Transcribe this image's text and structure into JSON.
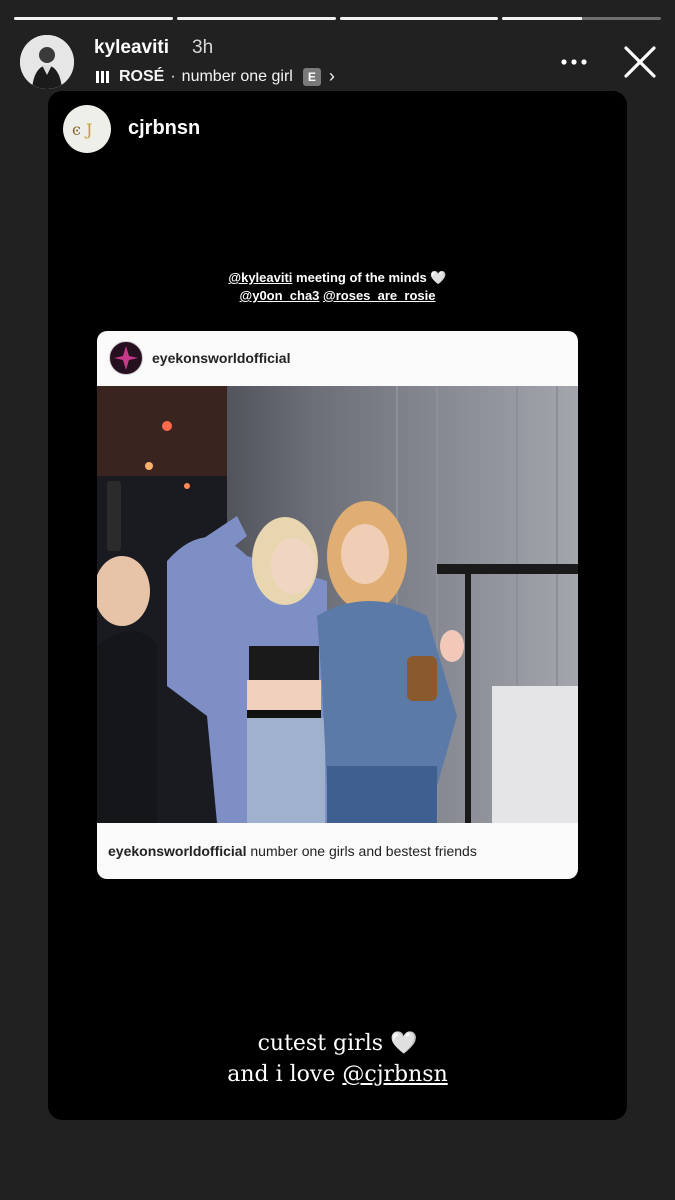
{
  "progress": [
    1.0,
    1.0,
    1.0,
    0.5
  ],
  "header": {
    "username": "kyleaviti",
    "time": "3h",
    "music": {
      "artist": "ROSÉ",
      "separator": " · ",
      "song": "number one girl",
      "explicit": "E"
    }
  },
  "story": {
    "username": "cjrbnsn",
    "caption_top": {
      "mention1": "@kyleaviti",
      "text1": " meeting of the minds 🤍",
      "mention2": "@y0on_cha3",
      "mention3": "@roses_are_rosie"
    },
    "post": {
      "username": "eyekonsworldofficial",
      "caption_user": "eyekonsworldofficial",
      "caption_text": " number one girls and bestest friends"
    },
    "caption_bottom": {
      "line1": "cutest girls 🤍",
      "line2_prefix": "and i love ",
      "line2_mention": "@cjrbnsn"
    }
  },
  "colors": {
    "background": "#212121",
    "story_bg": "#000000",
    "post_bg": "#fafafa"
  }
}
